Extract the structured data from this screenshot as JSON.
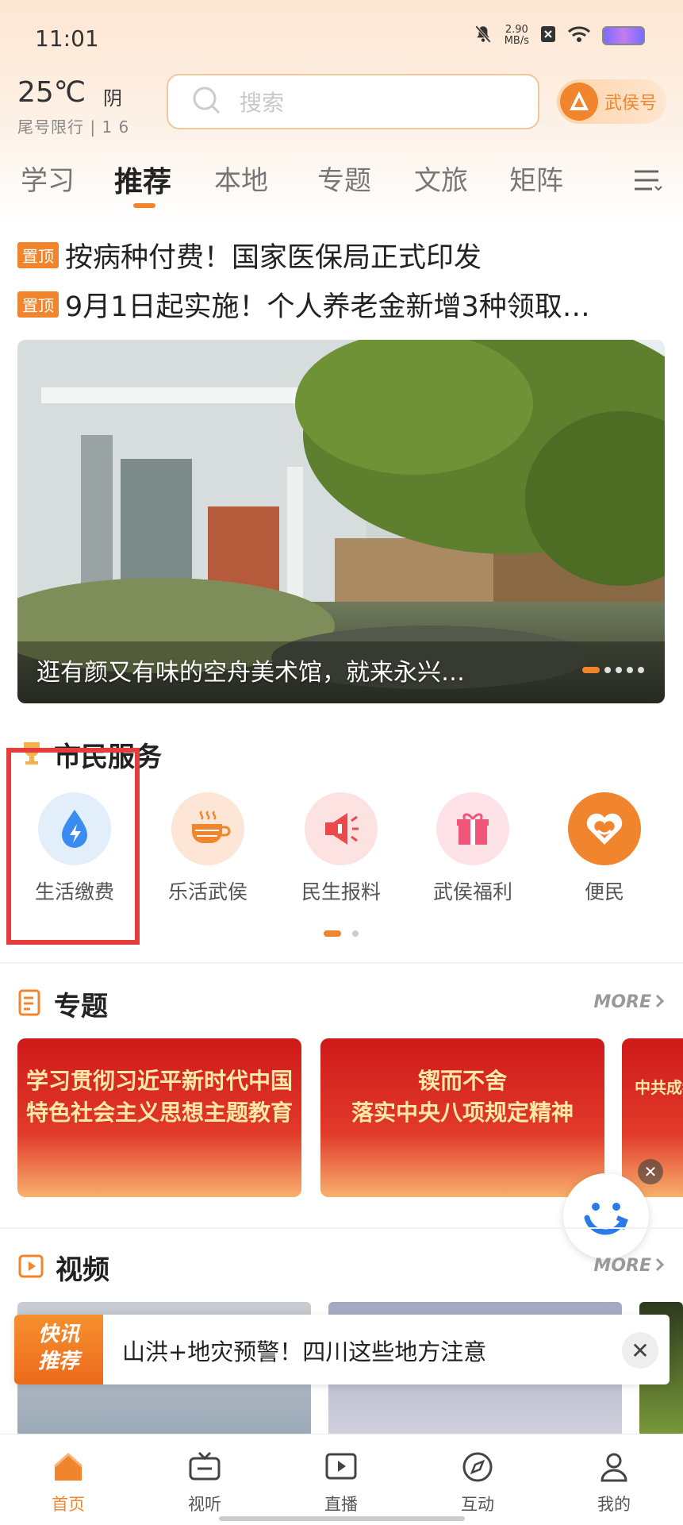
{
  "status_bar": {
    "time": "11:01",
    "net_speed": "2.90",
    "net_unit": "MB/s"
  },
  "header": {
    "temperature": "25℃",
    "weather": "阴",
    "plate_limit": "尾号限行 | 1 6",
    "search_placeholder": "搜索",
    "account_label": "武侯号"
  },
  "tabs": [
    {
      "label": "学习",
      "active": false
    },
    {
      "label": "推荐",
      "active": true
    },
    {
      "label": "本地",
      "active": false
    },
    {
      "label": "专题",
      "active": false
    },
    {
      "label": "文旅",
      "active": false
    },
    {
      "label": "矩阵",
      "active": false
    }
  ],
  "pinned": [
    {
      "badge": "置顶",
      "title": "按病种付费！国家医保局正式印发"
    },
    {
      "badge": "置顶",
      "title": "9月1日起实施！个人养老金新增3种领取…"
    }
  ],
  "banner": {
    "caption": "逛有颜又有味的空舟美术馆，就来永兴…"
  },
  "services": {
    "title": "市民服务",
    "items": [
      {
        "label": "生活缴费",
        "icon": "water-drop-lightning-icon"
      },
      {
        "label": "乐活武侯",
        "icon": "tea-cup-icon"
      },
      {
        "label": "民生报料",
        "icon": "megaphone-icon"
      },
      {
        "label": "武侯福利",
        "icon": "gift-icon"
      },
      {
        "label": "便民",
        "icon": "heart-icon"
      }
    ]
  },
  "topics": {
    "title": "专题",
    "more": "MORE",
    "cards": [
      {
        "line1": "学习贯彻习近平新时代中国",
        "line2": "特色社会主义思想主题教育"
      },
      {
        "line1": "锲而不舍",
        "line2": "落实中央八项规定精神"
      },
      {
        "line1": "中共成都",
        "line2": ""
      }
    ]
  },
  "videos": {
    "title": "视频",
    "more": "MORE"
  },
  "flash_news": {
    "badge_line1": "快讯",
    "badge_line2": "推荐",
    "text": "山洪+地灾预警！四川这些地方注意"
  },
  "bottom_nav": [
    {
      "label": "首页",
      "active": true
    },
    {
      "label": "视听",
      "active": false
    },
    {
      "label": "直播",
      "active": false
    },
    {
      "label": "互动",
      "active": false
    },
    {
      "label": "我的",
      "active": false
    }
  ],
  "colors": {
    "accent": "#f0852d",
    "highlight_box": "#e53c3c"
  }
}
